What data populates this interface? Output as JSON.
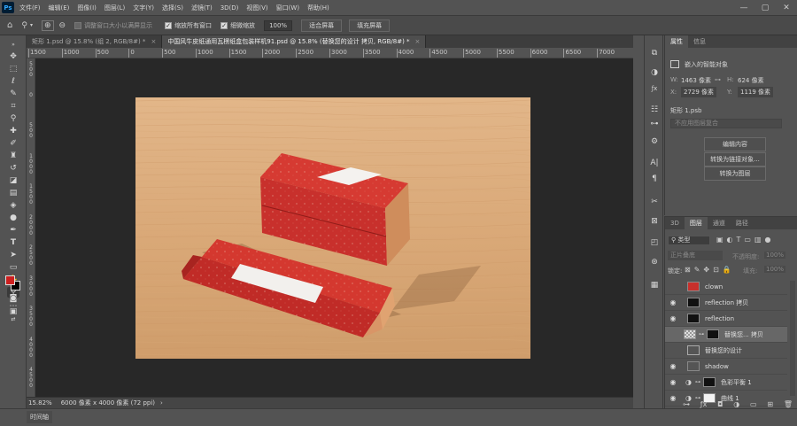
{
  "menubar": {
    "logo": "Ps",
    "items": [
      "文件(F)",
      "编辑(E)",
      "图像(I)",
      "图层(L)",
      "文字(Y)",
      "选择(S)",
      "滤镜(T)",
      "3D(D)",
      "视图(V)",
      "窗口(W)",
      "帮助(H)"
    ]
  },
  "options": {
    "resize_windows": "调整窗口大小以满屏显示",
    "zoom_all": "缩放所有窗口",
    "scrubby_zoom": "细微缩放",
    "zoom_value": "100%",
    "fit_screen": "适合屏幕",
    "fill_screen": "填充屏幕"
  },
  "tabs": [
    {
      "label": "矩形 1.psd @ 15.8% (组 2, RGB/8#) *",
      "close": "×"
    },
    {
      "label": "中国风牛皮纸通用瓦楞纸盒包装样机91.psd @ 15.8% (替换您的设计 拷贝, RGB/8#) *",
      "close": "×"
    }
  ],
  "ruler": {
    "top": [
      "1500",
      "1000",
      "500",
      "0",
      "500",
      "1000",
      "1500",
      "2000",
      "2500",
      "3000",
      "3500",
      "4000",
      "4500",
      "5000",
      "5500",
      "6000",
      "6500",
      "7000"
    ],
    "left": [
      "5\n0\n0",
      "0",
      "5\n0\n0",
      "1\n0\n0\n0",
      "1\n5\n0\n0",
      "2\n0\n0\n0",
      "2\n5\n0\n0",
      "3\n0\n0\n0",
      "3\n5\n0\n0",
      "4\n0\n0\n0",
      "4\n5\n0\n0"
    ]
  },
  "status": {
    "zoom": "15.82%",
    "doc_info": "6000 像素 x 4000 像素 (72 ppi)"
  },
  "timeline": "时间轴",
  "properties": {
    "tabs": [
      "属性",
      "信息"
    ],
    "object_type": "嵌入的智能对象",
    "w_label": "W:",
    "w_value": "1463 像素",
    "h_label": "H:",
    "h_value": "624 像素",
    "x_label": "X:",
    "x_value": "2729 像素",
    "y_label": "Y:",
    "y_value": "1119 像素",
    "file_name": "矩形 1.psb",
    "comp_placeholder": "不应用图层复合",
    "edit_contents": "编辑内容",
    "convert_linked": "转换为链接对象...",
    "convert_layers": "转换为图层"
  },
  "layers_panel": {
    "tabs": [
      "3D",
      "图层",
      "通道",
      "路径"
    ],
    "kind_filter": "类型",
    "blend_mode": "正片叠底",
    "opacity_label": "不透明度:",
    "opacity_value": "100%",
    "lock_label": "锁定:",
    "fill_label": "填充:",
    "fill_value": "100%",
    "layers": [
      {
        "name": "clown",
        "visible": false,
        "selected": false
      },
      {
        "name": "reflection 拷贝",
        "visible": true,
        "selected": false
      },
      {
        "name": "reflection",
        "visible": true,
        "selected": false
      },
      {
        "name": "替换您... 拷贝",
        "visible": false,
        "selected": true
      },
      {
        "name": "替换您的设计",
        "visible": false,
        "selected": false
      },
      {
        "name": "shadow",
        "visible": true,
        "selected": false
      },
      {
        "name": "色彩平衡 1",
        "visible": true,
        "selected": false
      },
      {
        "name": "曲线 1",
        "visible": true,
        "selected": false
      }
    ],
    "footer_icons": [
      "link-icon",
      "fx-icon",
      "mask-icon",
      "adjustment-icon",
      "group-icon",
      "new-layer-icon",
      "trash-icon"
    ]
  },
  "colors": {
    "foreground": "#cc1f1f",
    "background": "#000000",
    "box_red": "#c8302c"
  }
}
